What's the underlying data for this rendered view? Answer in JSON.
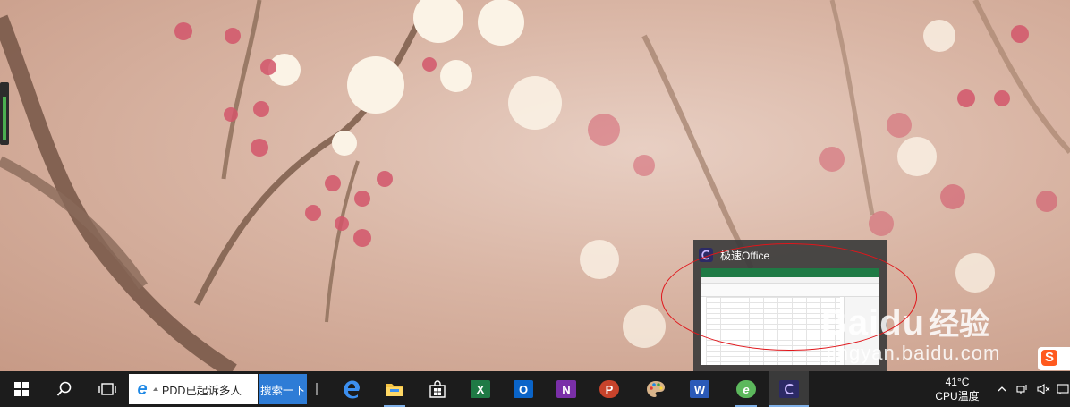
{
  "preview": {
    "app_title": "极速Office",
    "app_icon": "jisu-office-icon"
  },
  "watermark": {
    "brand": "Bai",
    "brand_paw": "du",
    "brand_cn": "经验",
    "site": "jingyan.baidu.com"
  },
  "taskbar": {
    "search_text": "PDD已起诉多人",
    "search_button": "搜索一下",
    "apps": [
      {
        "name": "edge",
        "icon": "edge-icon"
      },
      {
        "name": "file-explorer",
        "icon": "folder-icon"
      },
      {
        "name": "store",
        "icon": "store-icon"
      },
      {
        "name": "excel",
        "icon": "excel-icon",
        "letter": "X"
      },
      {
        "name": "outlook",
        "icon": "outlook-icon",
        "letter": "O"
      },
      {
        "name": "onenote",
        "icon": "onenote-icon",
        "letter": "N"
      },
      {
        "name": "powerpoint",
        "icon": "powerpoint-icon",
        "letter": "P"
      },
      {
        "name": "paint",
        "icon": "palette-icon"
      },
      {
        "name": "word",
        "icon": "word-icon",
        "letter": "W"
      },
      {
        "name": "browser-360",
        "icon": "browser-360-icon",
        "letter": "e"
      },
      {
        "name": "jisu-office",
        "icon": "jisu-office-icon"
      }
    ],
    "temperature": "41°C",
    "temperature_label": "CPU温度"
  },
  "colors": {
    "taskbar": "#1c1c1c",
    "search_button": "#2e7cd6",
    "annotation": "#e0161b",
    "excel": "#1f7a45",
    "outlook": "#0a64c8",
    "onenote": "#7a2fa8",
    "powerpoint": "#c8432b",
    "word": "#2b5ab8"
  }
}
